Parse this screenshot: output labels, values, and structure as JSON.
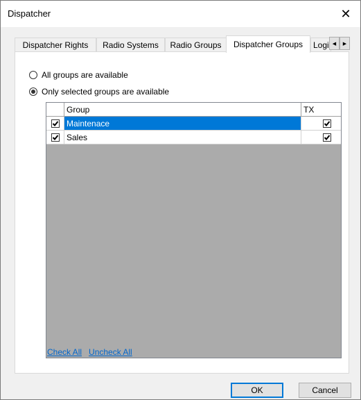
{
  "window": {
    "title": "Dispatcher",
    "close_glyph": "✕"
  },
  "tabs": [
    {
      "label": "Dispatcher Rights",
      "active": false
    },
    {
      "label": "Radio Systems",
      "active": false
    },
    {
      "label": "Radio Groups",
      "active": false
    },
    {
      "label": "Dispatcher Groups",
      "active": true
    },
    {
      "label": "Logic",
      "active": false
    }
  ],
  "tab_scroll": {
    "left_glyph": "◀",
    "right_glyph": "▶"
  },
  "availability": {
    "option_all": "All groups are available",
    "option_selected": "Only selected groups are available",
    "selected_option": "option_selected"
  },
  "grid": {
    "columns": {
      "group": "Group",
      "tx": "TX"
    },
    "rows": [
      {
        "checked": true,
        "group": "Maintenace",
        "tx": true,
        "selected": true
      },
      {
        "checked": true,
        "group": "Sales",
        "tx": true,
        "selected": false
      }
    ]
  },
  "links": {
    "check_all": "Check All",
    "uncheck_all": "Uncheck All"
  },
  "buttons": {
    "ok": "OK",
    "cancel": "Cancel"
  }
}
